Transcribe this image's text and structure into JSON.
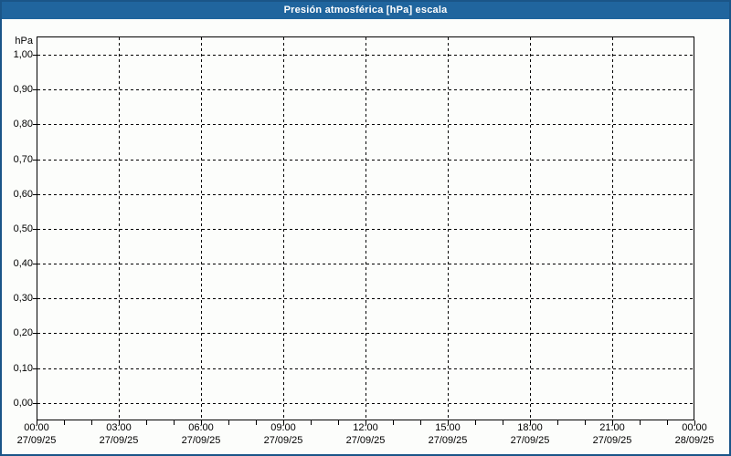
{
  "window": {
    "title": "Presión atmosférica [hPa] escala"
  },
  "colors": {
    "header_bg": "#20659e",
    "title_text": "#ffffff",
    "window_border": "#1a5588",
    "background": "#fcfdfb",
    "plot_border": "#000000",
    "grid": "#000000",
    "text": "#000000"
  },
  "chart_data": {
    "type": "line",
    "title": "Presión atmosférica [hPa] escala",
    "unit_label": "hPa",
    "series": [],
    "plot_empty": true,
    "grid": true,
    "legend": false,
    "y_axis": {
      "min": 0.0,
      "max": 1.0,
      "step": 0.1,
      "tick_labels": [
        "1,00",
        "0,90",
        "0,80",
        "0,70",
        "0,60",
        "0,50",
        "0,40",
        "0,30",
        "0,20",
        "0,10",
        "0,00"
      ]
    },
    "x_axis": {
      "start": "27/09/25 00:00",
      "end": "28/09/25 00:00",
      "major_tick_hours": 3,
      "minor_tick_hours": 1,
      "ticks": [
        {
          "time": "00:00",
          "date": "27/09/25"
        },
        {
          "time": "03:00",
          "date": "27/09/25"
        },
        {
          "time": "06:00",
          "date": "27/09/25"
        },
        {
          "time": "09:00",
          "date": "27/09/25"
        },
        {
          "time": "12:00",
          "date": "27/09/25"
        },
        {
          "time": "15:00",
          "date": "27/09/25"
        },
        {
          "time": "18:00",
          "date": "27/09/25"
        },
        {
          "time": "21:00",
          "date": "27/09/25"
        },
        {
          "time": "00:00",
          "date": "28/09/25"
        }
      ]
    }
  }
}
